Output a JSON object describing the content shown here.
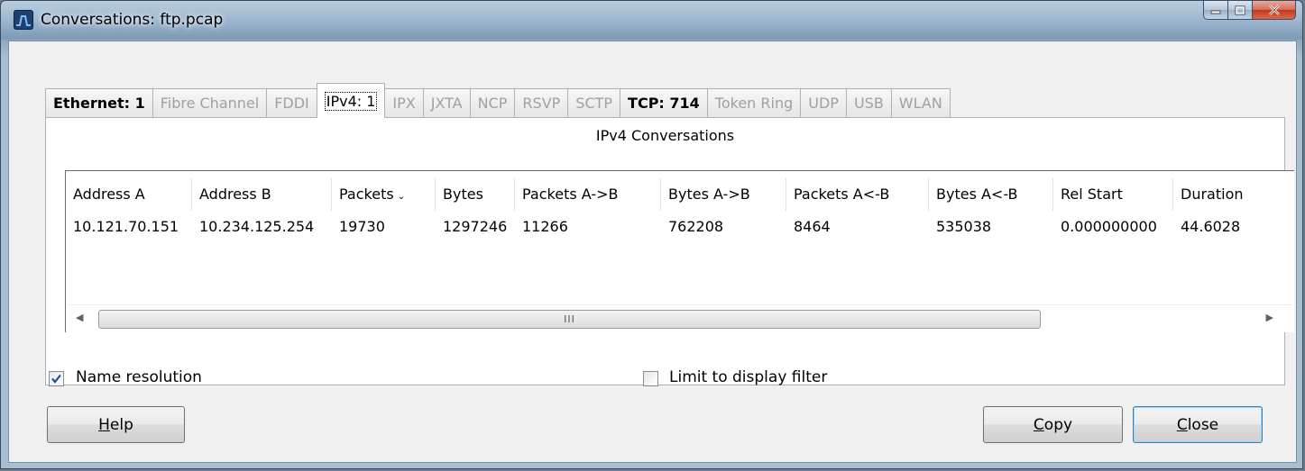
{
  "window": {
    "title": "Conversations: ftp.pcap"
  },
  "tabs": [
    {
      "label": "Ethernet: 1",
      "enabled": true,
      "bold": true
    },
    {
      "label": "Fibre Channel",
      "enabled": false
    },
    {
      "label": "FDDI",
      "enabled": false
    },
    {
      "label": "IPv4: 1",
      "enabled": true,
      "active": true
    },
    {
      "label": "IPX",
      "enabled": false
    },
    {
      "label": "JXTA",
      "enabled": false
    },
    {
      "label": "NCP",
      "enabled": false
    },
    {
      "label": "RSVP",
      "enabled": false
    },
    {
      "label": "SCTP",
      "enabled": false
    },
    {
      "label": "TCP: 714",
      "enabled": true,
      "bold": true
    },
    {
      "label": "Token Ring",
      "enabled": false
    },
    {
      "label": "UDP",
      "enabled": false
    },
    {
      "label": "USB",
      "enabled": false
    },
    {
      "label": "WLAN",
      "enabled": false
    }
  ],
  "panel": {
    "title": "IPv4 Conversations"
  },
  "table": {
    "columns": [
      "Address A",
      "Address B",
      "Packets",
      "Bytes",
      "Packets A->B",
      "Bytes A->B",
      "Packets A<-B",
      "Bytes A<-B",
      "Rel Start",
      "Duration"
    ],
    "rows": [
      [
        "10.121.70.151",
        "10.234.125.254",
        "19730",
        "1297246",
        "11266",
        "762208",
        "8464",
        "535038",
        "0.000000000",
        "44.6028"
      ]
    ],
    "scroll_thumb_grip": "III"
  },
  "options": {
    "name_resolution_label": "Name resolution",
    "name_resolution_checked": true,
    "limit_filter_label": "Limit to display filter",
    "limit_filter_checked": false
  },
  "buttons": {
    "help_label": "Help",
    "copy_label": "Copy",
    "close_label": "Close"
  }
}
